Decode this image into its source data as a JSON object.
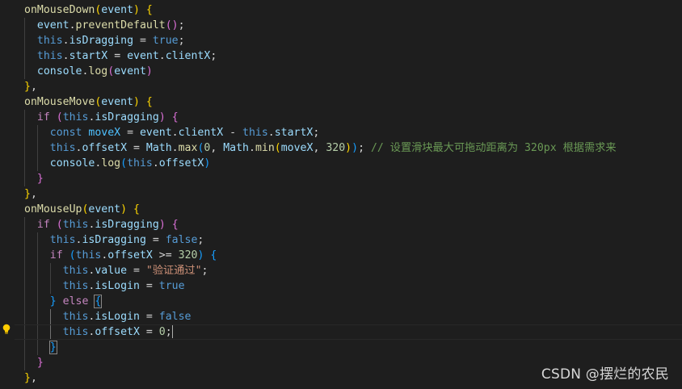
{
  "editor": {
    "watermark": "CSDN @摆烂的农民",
    "lines": [
      [
        [
          "fn",
          "onMouseDown"
        ],
        [
          "b1",
          "("
        ],
        [
          "prop",
          "event"
        ],
        [
          "b1",
          ")"
        ],
        [
          "pun",
          " "
        ],
        [
          "b1",
          "{"
        ]
      ],
      [
        [
          "pun",
          "  "
        ],
        [
          "prop",
          "event"
        ],
        [
          "pun",
          "."
        ],
        [
          "fn",
          "preventDefault"
        ],
        [
          "b2",
          "()"
        ],
        [
          "pun",
          ";"
        ]
      ],
      [
        [
          "pun",
          "  "
        ],
        [
          "kw",
          "this"
        ],
        [
          "pun",
          "."
        ],
        [
          "prop",
          "isDragging"
        ],
        [
          "pun",
          " = "
        ],
        [
          "kw",
          "true"
        ],
        [
          "pun",
          ";"
        ]
      ],
      [
        [
          "pun",
          "  "
        ],
        [
          "kw",
          "this"
        ],
        [
          "pun",
          "."
        ],
        [
          "prop",
          "startX"
        ],
        [
          "pun",
          " = "
        ],
        [
          "prop",
          "event"
        ],
        [
          "pun",
          "."
        ],
        [
          "prop",
          "clientX"
        ],
        [
          "pun",
          ";"
        ]
      ],
      [
        [
          "pun",
          "  "
        ],
        [
          "prop",
          "console"
        ],
        [
          "pun",
          "."
        ],
        [
          "fn",
          "log"
        ],
        [
          "b2",
          "("
        ],
        [
          "prop",
          "event"
        ],
        [
          "b2",
          ")"
        ]
      ],
      [
        [
          "b1",
          "}"
        ],
        [
          "pun",
          ","
        ]
      ],
      [
        [
          "fn",
          "onMouseMove"
        ],
        [
          "b1",
          "("
        ],
        [
          "prop",
          "event"
        ],
        [
          "b1",
          ")"
        ],
        [
          "pun",
          " "
        ],
        [
          "b1",
          "{"
        ]
      ],
      [
        [
          "pun",
          "  "
        ],
        [
          "ctl",
          "if"
        ],
        [
          "pun",
          " "
        ],
        [
          "b2",
          "("
        ],
        [
          "kw",
          "this"
        ],
        [
          "pun",
          "."
        ],
        [
          "prop",
          "isDragging"
        ],
        [
          "b2",
          ")"
        ],
        [
          "pun",
          " "
        ],
        [
          "b2",
          "{"
        ]
      ],
      [
        [
          "pun",
          "    "
        ],
        [
          "kw",
          "const"
        ],
        [
          "pun",
          " "
        ],
        [
          "var",
          "moveX"
        ],
        [
          "pun",
          " = "
        ],
        [
          "prop",
          "event"
        ],
        [
          "pun",
          "."
        ],
        [
          "prop",
          "clientX"
        ],
        [
          "pun",
          " - "
        ],
        [
          "kw",
          "this"
        ],
        [
          "pun",
          "."
        ],
        [
          "prop",
          "startX"
        ],
        [
          "pun",
          ";"
        ]
      ],
      [
        [
          "pun",
          "    "
        ],
        [
          "kw",
          "this"
        ],
        [
          "pun",
          "."
        ],
        [
          "prop",
          "offsetX"
        ],
        [
          "pun",
          " = "
        ],
        [
          "prop",
          "Math"
        ],
        [
          "pun",
          "."
        ],
        [
          "fn",
          "max"
        ],
        [
          "b3",
          "("
        ],
        [
          "num",
          "0"
        ],
        [
          "pun",
          ", "
        ],
        [
          "prop",
          "Math"
        ],
        [
          "pun",
          "."
        ],
        [
          "fn",
          "min"
        ],
        [
          "b1",
          "("
        ],
        [
          "prop",
          "moveX"
        ],
        [
          "pun",
          ", "
        ],
        [
          "num",
          "320"
        ],
        [
          "b1",
          ")"
        ],
        [
          "b3",
          ")"
        ],
        [
          "pun",
          "; "
        ],
        [
          "cmt",
          "// 设置滑块最大可拖动距离为 320px 根据需求来"
        ]
      ],
      [
        [
          "pun",
          "    "
        ],
        [
          "prop",
          "console"
        ],
        [
          "pun",
          "."
        ],
        [
          "fn",
          "log"
        ],
        [
          "b3",
          "("
        ],
        [
          "kw",
          "this"
        ],
        [
          "pun",
          "."
        ],
        [
          "prop",
          "offsetX"
        ],
        [
          "b3",
          ")"
        ]
      ],
      [
        [
          "pun",
          "  "
        ],
        [
          "b2",
          "}"
        ]
      ],
      [
        [
          "b1",
          "}"
        ],
        [
          "pun",
          ","
        ]
      ],
      [
        [
          "fn",
          "onMouseUp"
        ],
        [
          "b1",
          "("
        ],
        [
          "prop",
          "event"
        ],
        [
          "b1",
          ")"
        ],
        [
          "pun",
          " "
        ],
        [
          "b1",
          "{"
        ]
      ],
      [
        [
          "pun",
          "  "
        ],
        [
          "ctl",
          "if"
        ],
        [
          "pun",
          " "
        ],
        [
          "b2",
          "("
        ],
        [
          "kw",
          "this"
        ],
        [
          "pun",
          "."
        ],
        [
          "prop",
          "isDragging"
        ],
        [
          "b2",
          ")"
        ],
        [
          "pun",
          " "
        ],
        [
          "b2",
          "{"
        ]
      ],
      [
        [
          "pun",
          "    "
        ],
        [
          "kw",
          "this"
        ],
        [
          "pun",
          "."
        ],
        [
          "prop",
          "isDragging"
        ],
        [
          "pun",
          " = "
        ],
        [
          "kw",
          "false"
        ],
        [
          "pun",
          ";"
        ]
      ],
      [
        [
          "pun",
          "    "
        ],
        [
          "ctl",
          "if"
        ],
        [
          "pun",
          " "
        ],
        [
          "b3",
          "("
        ],
        [
          "kw",
          "this"
        ],
        [
          "pun",
          "."
        ],
        [
          "prop",
          "offsetX"
        ],
        [
          "pun",
          " >= "
        ],
        [
          "num",
          "320"
        ],
        [
          "b3",
          ")"
        ],
        [
          "pun",
          " "
        ],
        [
          "b3",
          "{"
        ]
      ],
      [
        [
          "pun",
          "      "
        ],
        [
          "kw",
          "this"
        ],
        [
          "pun",
          "."
        ],
        [
          "prop",
          "value"
        ],
        [
          "pun",
          " = "
        ],
        [
          "str",
          "\"验证通过\""
        ],
        [
          "pun",
          ";"
        ]
      ],
      [
        [
          "pun",
          "      "
        ],
        [
          "kw",
          "this"
        ],
        [
          "pun",
          "."
        ],
        [
          "prop",
          "isLogin"
        ],
        [
          "pun",
          " = "
        ],
        [
          "kw",
          "true"
        ]
      ],
      [
        [
          "pun",
          "    "
        ],
        [
          "b3",
          "}"
        ],
        [
          "pun",
          " "
        ],
        [
          "ctl",
          "else"
        ],
        [
          "pun",
          " "
        ],
        [
          "b3m",
          "{"
        ]
      ],
      [
        [
          "pun",
          "      "
        ],
        [
          "kw",
          "this"
        ],
        [
          "pun",
          "."
        ],
        [
          "prop",
          "isLogin"
        ],
        [
          "pun",
          " = "
        ],
        [
          "kw",
          "false"
        ]
      ],
      [
        [
          "pun",
          "      "
        ],
        [
          "kw",
          "this"
        ],
        [
          "pun",
          "."
        ],
        [
          "prop",
          "offsetX"
        ],
        [
          "pun",
          " = "
        ],
        [
          "num",
          "0"
        ],
        [
          "pun",
          ";"
        ],
        [
          "cursor",
          ""
        ]
      ],
      [
        [
          "pun",
          "    "
        ],
        [
          "b3m",
          "}"
        ]
      ],
      [
        [
          "pun",
          "  "
        ],
        [
          "b2",
          "}"
        ]
      ],
      [
        [
          "b1",
          "}"
        ],
        [
          "pun",
          ","
        ]
      ]
    ],
    "current_line": 21
  }
}
